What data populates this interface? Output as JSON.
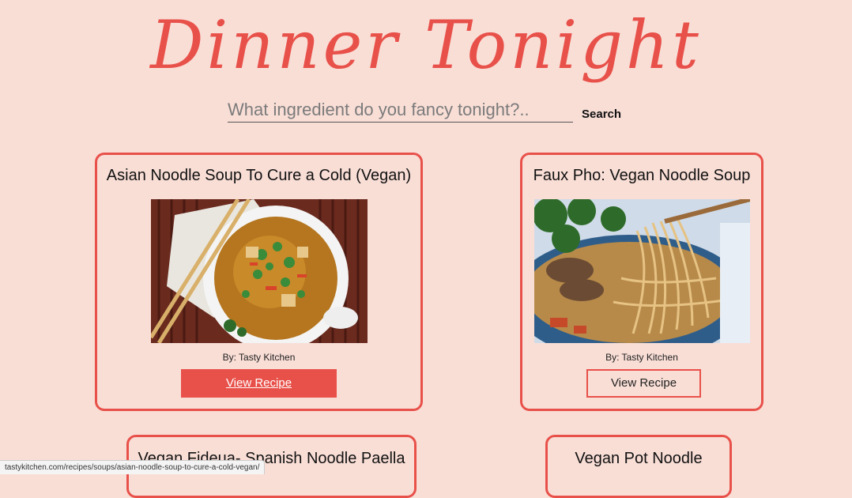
{
  "header": {
    "title": "Dinner Tonight"
  },
  "search": {
    "placeholder": "What ingredient do you fancy tonight?..",
    "button_label": "Search"
  },
  "recipes": [
    {
      "title": "Asian Noodle Soup To Cure a Cold (Vegan)",
      "author": "By: Tasty Kitchen",
      "button_label": "View Recipe",
      "image": "asian-noodle-soup-photo"
    },
    {
      "title": "Faux Pho: Vegan Noodle Soup",
      "author": "By: Tasty Kitchen",
      "button_label": "View Recipe",
      "image": "faux-pho-noodles-photo"
    },
    {
      "title": "Vegan Fideua- Spanish Noodle Paella"
    },
    {
      "title": "Vegan Pot Noodle"
    }
  ],
  "status_bar": {
    "url": "tastykitchen.com/recipes/soups/asian-noodle-soup-to-cure-a-cold-vegan/"
  },
  "colors": {
    "accent": "#e8514a",
    "background": "#f9ded6"
  }
}
